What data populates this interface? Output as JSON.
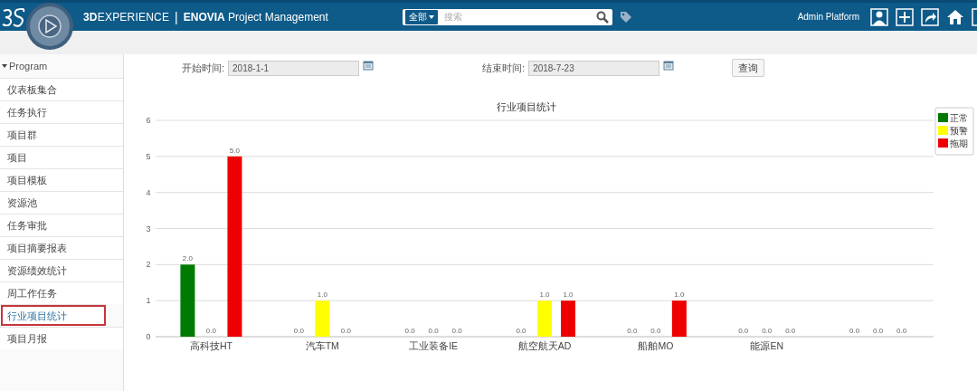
{
  "header": {
    "product": "**3D**EXPERIENCE",
    "divider": "|",
    "app": "**ENOVIA** Project Management",
    "search": {
      "scope": "全部",
      "placeholder": "搜索"
    },
    "user": "Admin Platform"
  },
  "sidebar": {
    "title": "Program",
    "expanded": true,
    "items": [
      {
        "label": "仪表板集合",
        "selected": false
      },
      {
        "label": "任务执行",
        "selected": false
      },
      {
        "label": "项目群",
        "selected": false
      },
      {
        "label": "项目",
        "selected": false
      },
      {
        "label": "项目模板",
        "selected": false
      },
      {
        "label": "资源池",
        "selected": false
      },
      {
        "label": "任务审批",
        "selected": false
      },
      {
        "label": "项目摘要报表",
        "selected": false
      },
      {
        "label": "资源绩效统计",
        "selected": false
      },
      {
        "label": "周工作任务",
        "selected": false
      },
      {
        "label": "行业项目统计",
        "selected": true
      },
      {
        "label": "项目月报",
        "selected": false
      }
    ]
  },
  "filters": {
    "start": {
      "label": "开始时间:",
      "value": "2018-1-1"
    },
    "end": {
      "label": "结束时间:",
      "value": "2018-7-23"
    },
    "button": "查询"
  },
  "chart": {
    "chart_data": {
      "type": "bar",
      "title": "行业项目统计",
      "categories": [
        "高科技HT",
        "汽车TM",
        "工业装备IE",
        "航空航天AD",
        "船舶MO",
        "能源EN",
        null
      ],
      "series": [
        {
          "name": "正常",
          "color": "#007a00",
          "values": [
            2,
            0,
            0,
            0,
            0,
            0,
            0
          ]
        },
        {
          "name": "预警",
          "color": "#ffff00",
          "values": [
            0,
            1,
            0,
            1,
            0,
            0,
            0
          ]
        },
        {
          "name": "拖期",
          "color": "#ee0000",
          "values": [
            5,
            0,
            0,
            1,
            1,
            0,
            0
          ]
        }
      ],
      "ylim": [
        0,
        6
      ],
      "yticks": [
        0,
        1,
        2,
        3,
        4,
        5,
        6
      ],
      "grid": true,
      "legend": true,
      "value_labels": [
        [
          "2.0",
          "0.0",
          "0.0",
          "0.0",
          "0.0",
          "0.0",
          "0.0"
        ],
        [
          "0.0",
          "1.0",
          "0.0",
          "1.0",
          "0.0",
          "0.0",
          "0.0"
        ],
        [
          "5.0",
          "0.0",
          "0.0",
          "1.0",
          "1.0",
          "0.0",
          "0.0"
        ]
      ]
    }
  }
}
